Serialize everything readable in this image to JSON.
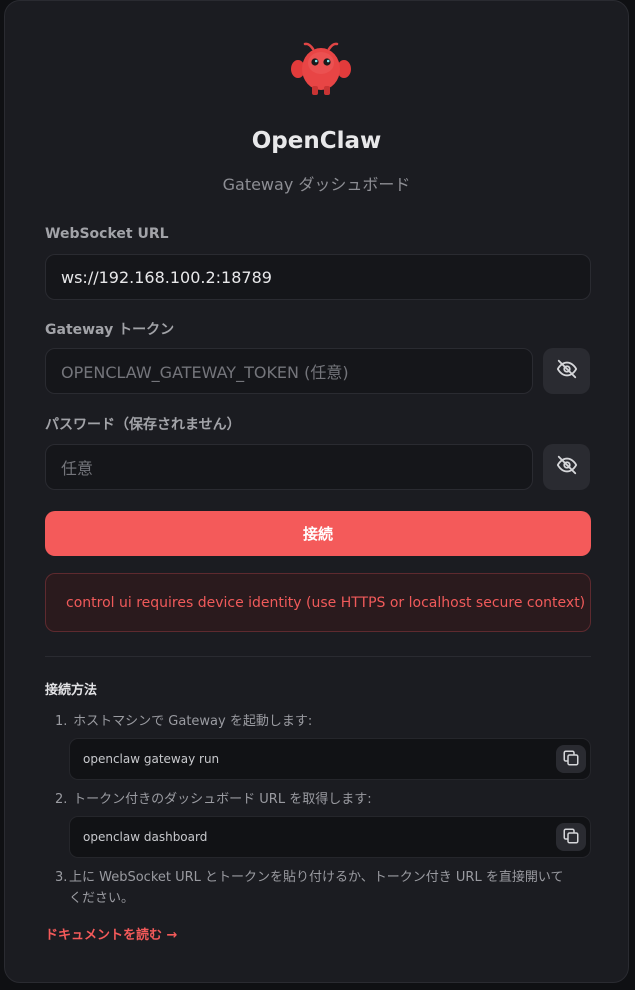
{
  "app": {
    "title": "OpenClaw",
    "subtitle": "Gateway ダッシュボード"
  },
  "form": {
    "ws_label": "WebSocket URL",
    "ws_value": "ws://192.168.100.2:18789",
    "token_label": "Gateway トークン",
    "token_placeholder": "OPENCLAW_GATEWAY_TOKEN (任意)",
    "password_label": "パスワード（保存されません）",
    "password_placeholder": "任意",
    "connect_label": "接続"
  },
  "error": {
    "message": "control ui requires device identity (use HTTPS or localhost secure context)"
  },
  "howto": {
    "title": "接続方法",
    "steps": [
      {
        "num": "1.",
        "text": "ホストマシンで Gateway を起動します:",
        "command": "openclaw gateway run"
      },
      {
        "num": "2.",
        "text": "トークン付きのダッシュボード URL を取得します:",
        "command": "openclaw dashboard"
      },
      {
        "num": "3.",
        "text_line1": "上に WebSocket URL とトークンを貼り付けるか、トークン付き URL を直接開いて",
        "text_line2": "ください。"
      }
    ],
    "docs_link": "ドキュメントを読む →"
  },
  "colors": {
    "accent": "#f45a5a",
    "background": "#1b1c21",
    "error_text": "#f05a5a"
  },
  "icons": {
    "logo": "openclaw-mascot-icon",
    "visibility": "eye-off-icon",
    "copy": "copy-icon"
  }
}
